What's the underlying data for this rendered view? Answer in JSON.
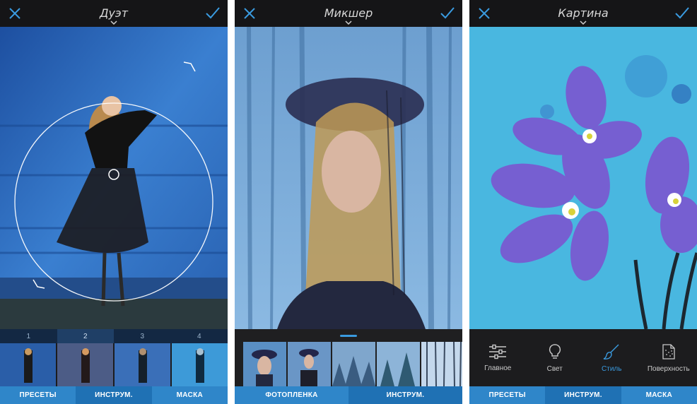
{
  "screens": [
    {
      "title": "Дуэт",
      "presets": [
        "1",
        "2",
        "3",
        "4"
      ],
      "selected_preset": "2",
      "tabs": [
        "ПРЕСЕТЫ",
        "ИНСТРУМ.",
        "МАСКА"
      ]
    },
    {
      "title": "Микшер",
      "tabs": [
        "ФОТОПЛЕНКА",
        "ИНСТРУМ."
      ]
    },
    {
      "title": "Картина",
      "tools": [
        "Главное",
        "Свет",
        "Стиль",
        "Поверхность"
      ],
      "active_tool": "Стиль",
      "tabs": [
        "ПРЕСЕТЫ",
        "ИНСТРУМ.",
        "МАСКА"
      ]
    }
  ],
  "colors": {
    "accent": "#3a9be0",
    "tab_bar": "#2f86c9",
    "top_bar": "#151517"
  },
  "icons": {
    "close": "close-icon",
    "confirm": "checkmark-icon",
    "expand": "chevron-down-icon",
    "main_tool": "sliders-icon",
    "light_tool": "lightbulb-icon",
    "style_tool": "brush-icon",
    "surface_tool": "texture-icon"
  }
}
